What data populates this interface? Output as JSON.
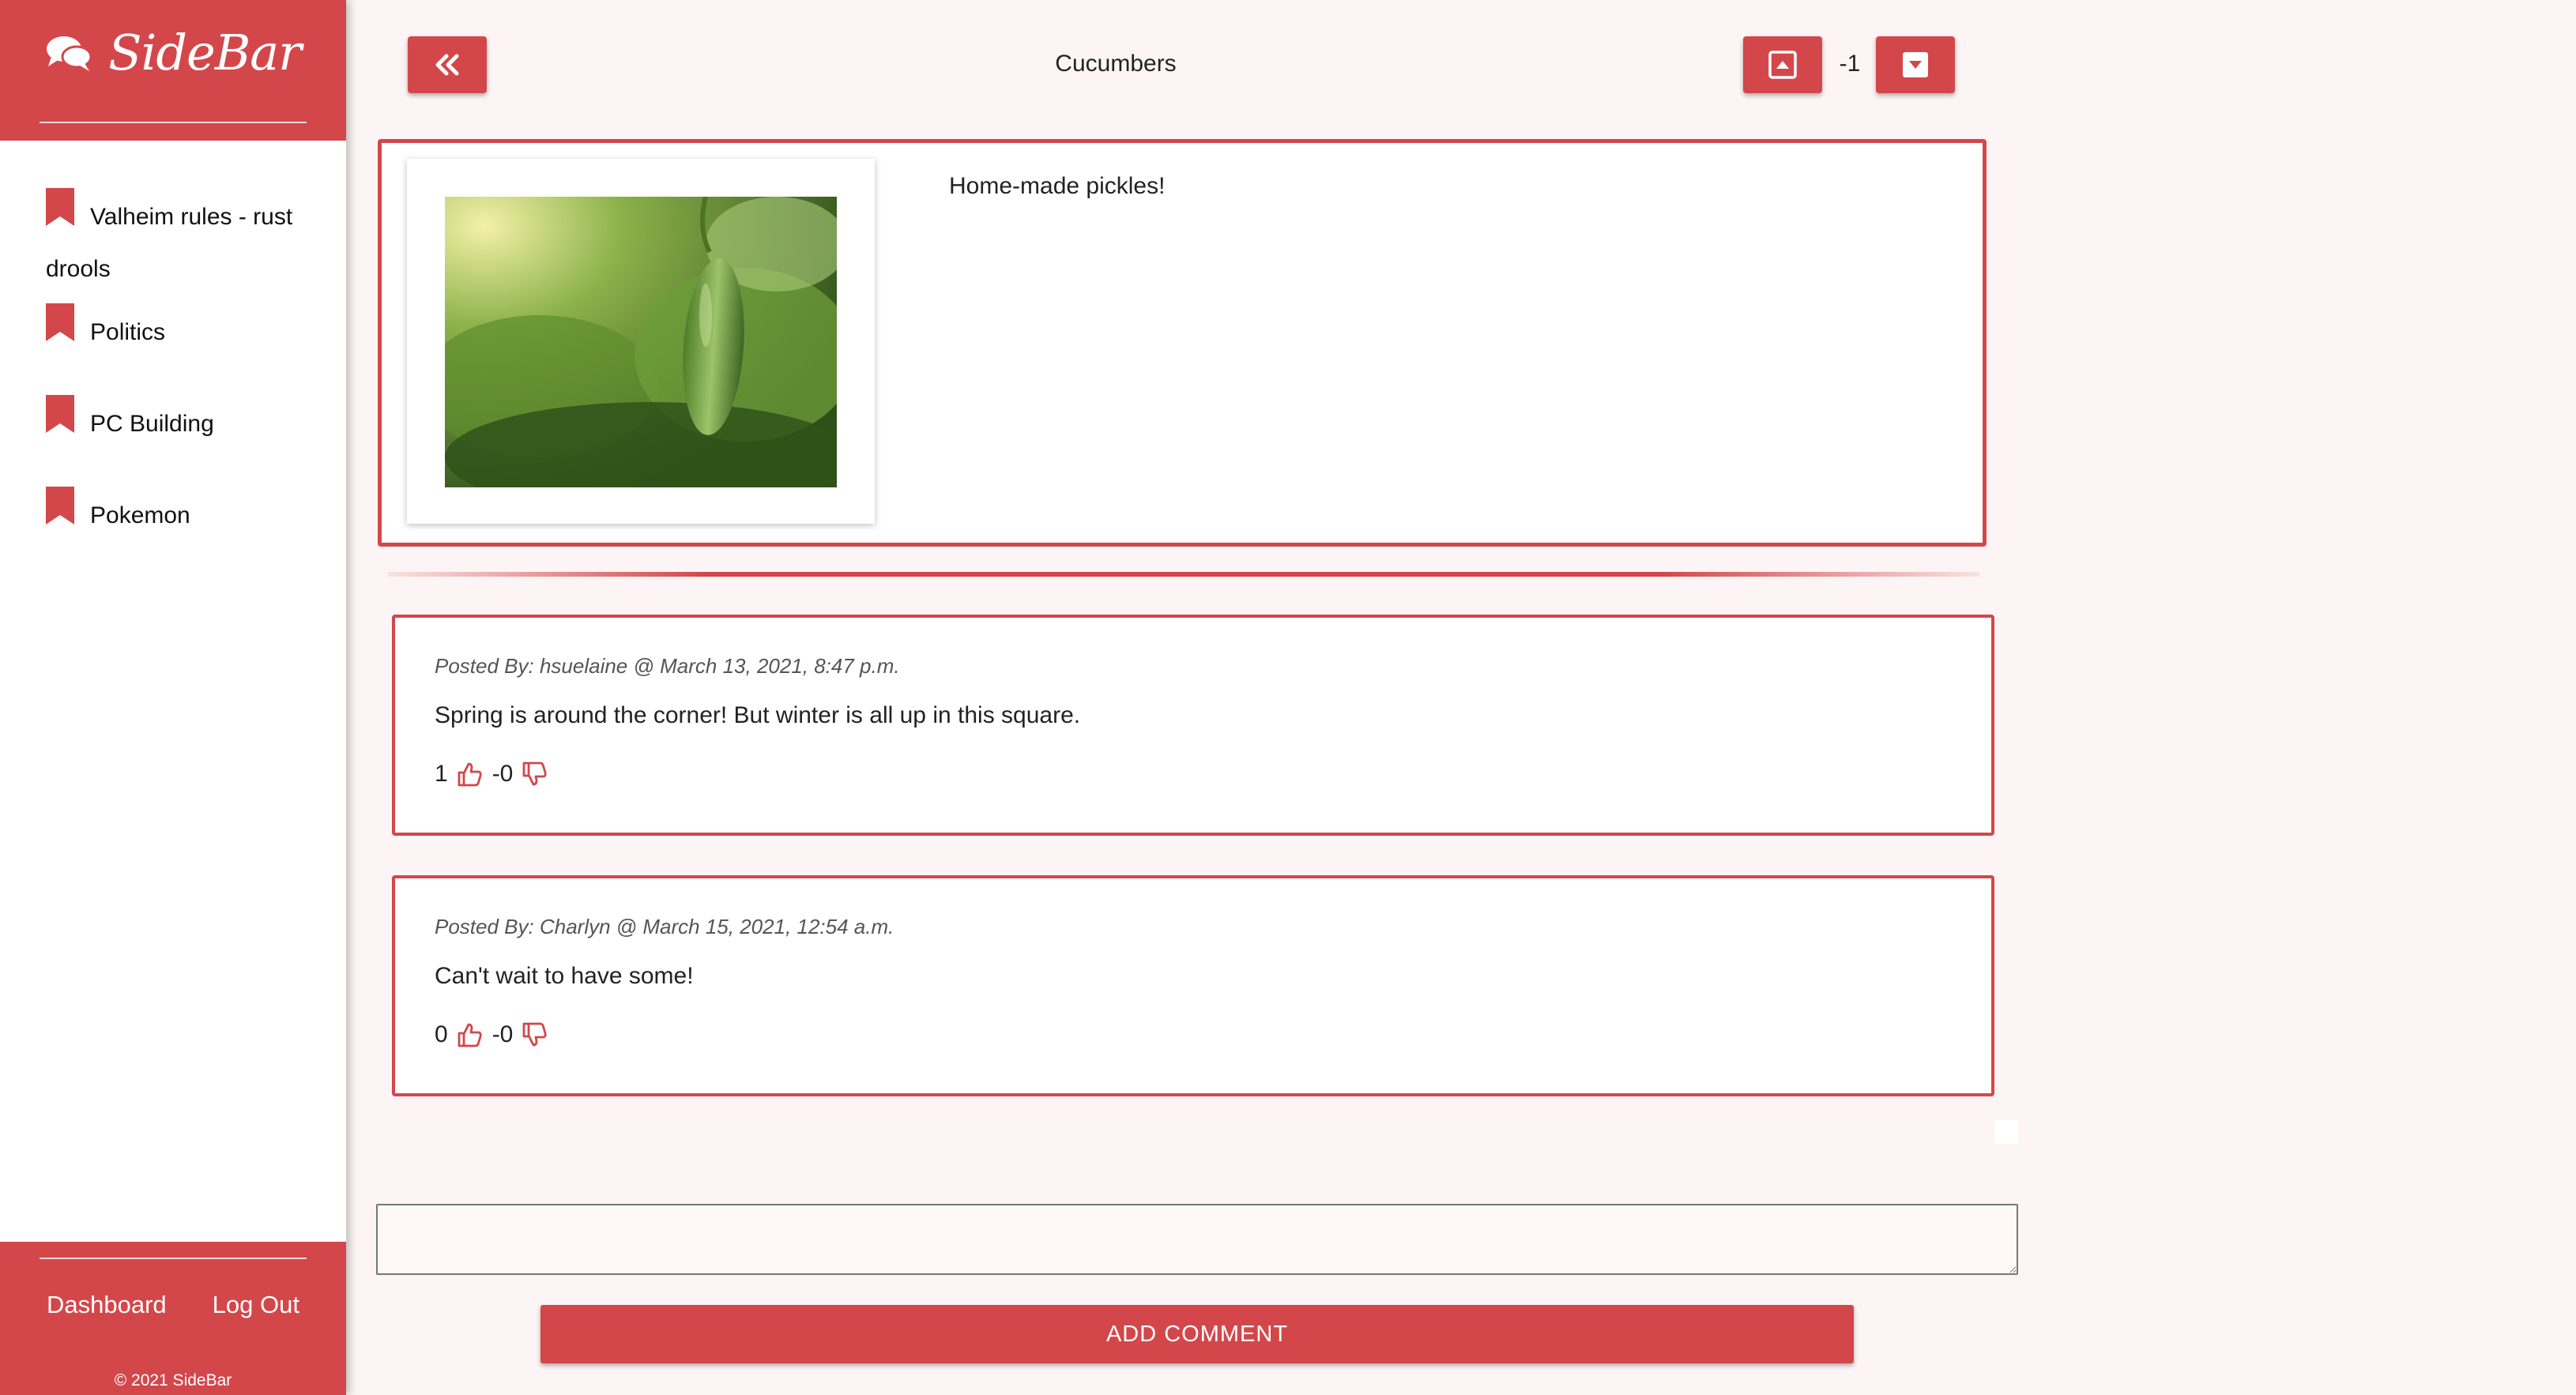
{
  "sidebar": {
    "brand": "SideBar",
    "brand_icon": "chat-bubbles-icon",
    "items": [
      {
        "label": "Valheim rules - rust drools",
        "icon": "bookmark-icon"
      },
      {
        "label": "Politics",
        "icon": "bookmark-icon"
      },
      {
        "label": "PC Building",
        "icon": "bookmark-icon"
      },
      {
        "label": "Pokemon",
        "icon": "bookmark-icon"
      }
    ],
    "footer": {
      "dashboard": "Dashboard",
      "logout": "Log Out",
      "copyright": "© 2021 SideBar"
    }
  },
  "header": {
    "back_icon": "double-chevron-left-icon",
    "title": "Cucumbers",
    "upvote_icon": "caret-up-square-icon",
    "score": "-1",
    "downvote_icon": "caret-down-square-icon"
  },
  "post": {
    "image": "cucumber-photo",
    "body": "Home-made pickles!"
  },
  "comments": [
    {
      "meta": "Posted By: hsuelaine @ March 13, 2021, 8:47 p.m.",
      "text": "Spring is around the corner! But winter is all up in this square.",
      "likes": "1",
      "dislikes": "-0"
    },
    {
      "meta": "Posted By: Charlyn @ March 15, 2021, 12:54 a.m.",
      "text": "Can't wait to have some!",
      "likes": "0",
      "dislikes": "-0"
    }
  ],
  "comment_form": {
    "input_value": "",
    "submit_label": "ADD COMMENT"
  },
  "colors": {
    "accent": "#d3474b",
    "background": "#fdf5f5"
  }
}
